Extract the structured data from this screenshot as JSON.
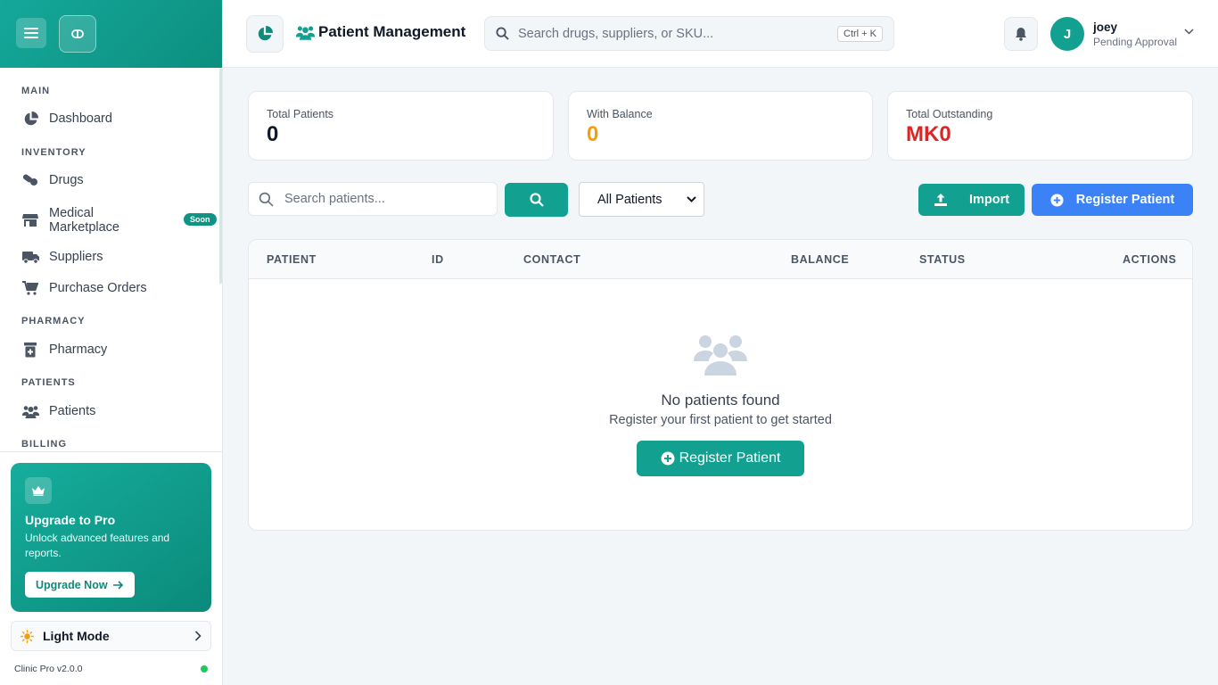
{
  "sidebar": {
    "sections": [
      {
        "title": "MAIN"
      },
      {
        "title": "INVENTORY"
      },
      {
        "title": "PHARMACY"
      },
      {
        "title": "PATIENTS"
      },
      {
        "title": "BILLING"
      }
    ],
    "items": [
      {
        "label": "Dashboard",
        "icon": "pie-chart-icon"
      },
      {
        "label": "Drugs",
        "icon": "pills-icon"
      },
      {
        "label": "Medical Marketplace",
        "icon": "store-icon",
        "badge": "Soon"
      },
      {
        "label": "Suppliers",
        "icon": "truck-icon"
      },
      {
        "label": "Purchase Orders",
        "icon": "cart-icon"
      },
      {
        "label": "Pharmacy",
        "icon": "prescription-bottle-icon"
      },
      {
        "label": "Patients",
        "icon": "users-icon"
      }
    ],
    "upgrade": {
      "title": "Upgrade to Pro",
      "text": "Unlock advanced features and reports.",
      "button": "Upgrade Now"
    },
    "mode_label": "Light Mode",
    "version": "Clinic Pro v2.0.0"
  },
  "header": {
    "title": "Patient Management",
    "search_placeholder": "Search drugs, suppliers, or SKU...",
    "shortcut": "Ctrl + K",
    "user": {
      "initial": "J",
      "name": "joey",
      "status": "Pending Approval"
    }
  },
  "stats": [
    {
      "label": "Total Patients",
      "value": "0",
      "color": "#111827"
    },
    {
      "label": "With Balance",
      "value": "0",
      "color": "#f59e0b"
    },
    {
      "label": "Total Outstanding",
      "value": "MK0",
      "color": "#dc2626"
    }
  ],
  "toolbar": {
    "search_placeholder": "Search patients...",
    "filter_value": "All Patients",
    "import_label": "Import",
    "register_label": "Register Patient"
  },
  "table": {
    "columns": [
      "PATIENT",
      "ID",
      "CONTACT",
      "BALANCE",
      "STATUS",
      "ACTIONS"
    ],
    "empty_title": "No patients found",
    "empty_subtitle": "Register your first patient to get started",
    "empty_button": "Register Patient"
  },
  "colors": {
    "brand": "#12a090",
    "primary_blue": "#3b82f6",
    "warning": "#f59e0b",
    "danger": "#dc2626",
    "online": "#22c55e"
  }
}
